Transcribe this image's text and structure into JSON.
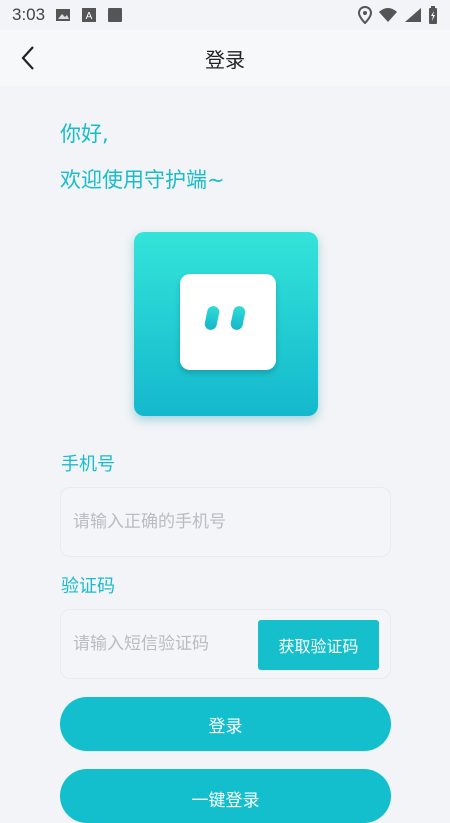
{
  "status_bar": {
    "time": "3:03",
    "left_icons": [
      "image-icon",
      "a-icon",
      "square-icon"
    ],
    "right_icons": [
      "location-icon",
      "wifi-icon",
      "signal-icon",
      "battery-icon"
    ]
  },
  "nav": {
    "title": "登录"
  },
  "greeting": {
    "line1": "你好,",
    "line2": "欢迎使用守护端~"
  },
  "phone": {
    "label": "手机号",
    "placeholder": "请输入正确的手机号",
    "value": ""
  },
  "code": {
    "label": "验证码",
    "placeholder": "请输入短信验证码",
    "value": "",
    "get_code_label": "获取验证码"
  },
  "buttons": {
    "login_label": "登录",
    "quick_login_label": "一键登录"
  },
  "colors": {
    "accent": "#15bfcc",
    "background": "#f2f4f7"
  }
}
